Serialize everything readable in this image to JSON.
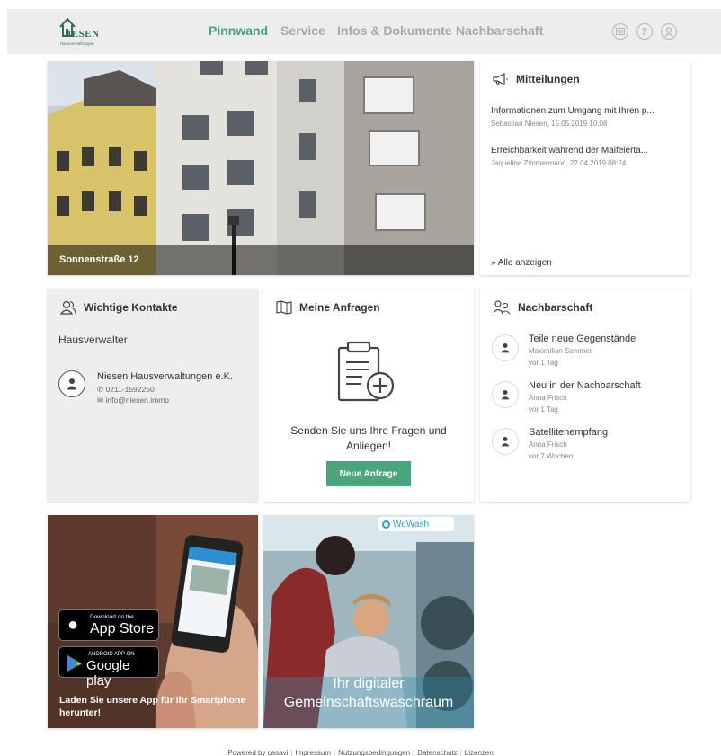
{
  "brand": {
    "logo_text": "IESEN",
    "logo_sub": "Hausverwaltungen"
  },
  "nav": [
    {
      "label": "Pinnwand",
      "active": true
    },
    {
      "label": "Service",
      "active": false
    },
    {
      "label": "Infos & Dokumente",
      "active": false
    },
    {
      "label": "Nachbarschaft",
      "active": false
    }
  ],
  "header_icons": [
    "messages-icon",
    "help-icon",
    "profile-icon"
  ],
  "hero": {
    "caption": "Sonnenstraße 12"
  },
  "mitteilungen": {
    "title": "Mitteilungen",
    "items": [
      {
        "title": "Informationen zum Umgang mit Ihren p...",
        "meta": "Sebastian Niesen, 15.05.2019 10:08"
      },
      {
        "title": "Erreichbarkeit während der Maifeierta...",
        "meta": "Jaqueline Zimmermann, 22.04.2019 08:24"
      }
    ],
    "show_all": "» Alle anzeigen"
  },
  "kontakte": {
    "title": "Wichtige Kontakte",
    "role": "Hausverwalter",
    "name": "Niesen Hausverwaltungen e.K.",
    "phone": "0211-1592250",
    "email": "info@niesen.immo"
  },
  "anfragen": {
    "title": "Meine Anfragen",
    "text": "Senden Sie uns Ihre Fragen und Anliegen!",
    "button": "Neue Anfrage"
  },
  "nachbarschaft": {
    "title": "Nachbarschaft",
    "items": [
      {
        "title": "Teile neue Gegenstände",
        "author": "Maximilian Sommer",
        "time": "vor 1 Tag"
      },
      {
        "title": "Neu in der Nachbarschaft",
        "author": "Anna Frisch",
        "time": "vor 1 Tag"
      },
      {
        "title": "Satellitenempfang",
        "author": "Anna Frisch",
        "time": "vor 2 Wochen"
      }
    ]
  },
  "app_promo": {
    "appstore_small": "Download on the",
    "appstore_big": "App Store",
    "play_small": "ANDROID APP ON",
    "play_big": "Google play",
    "caption": "Laden Sie unsere App für Ihr Smartphone herunter!"
  },
  "wash_promo": {
    "brand": "WeWash",
    "caption_line1": "Ihr digitaler",
    "caption_line2": "Gemeinschaftswaschraum"
  },
  "footer": {
    "powered": "Powered by casavi",
    "links": [
      "Impressum",
      "Nutzungsbedingungen",
      "Datenschutz",
      "Lizenzen"
    ]
  },
  "colors": {
    "accent": "#45a679",
    "button": "#4aa57d",
    "header_bg": "#ededed",
    "grey_card": "#eeeeee"
  }
}
